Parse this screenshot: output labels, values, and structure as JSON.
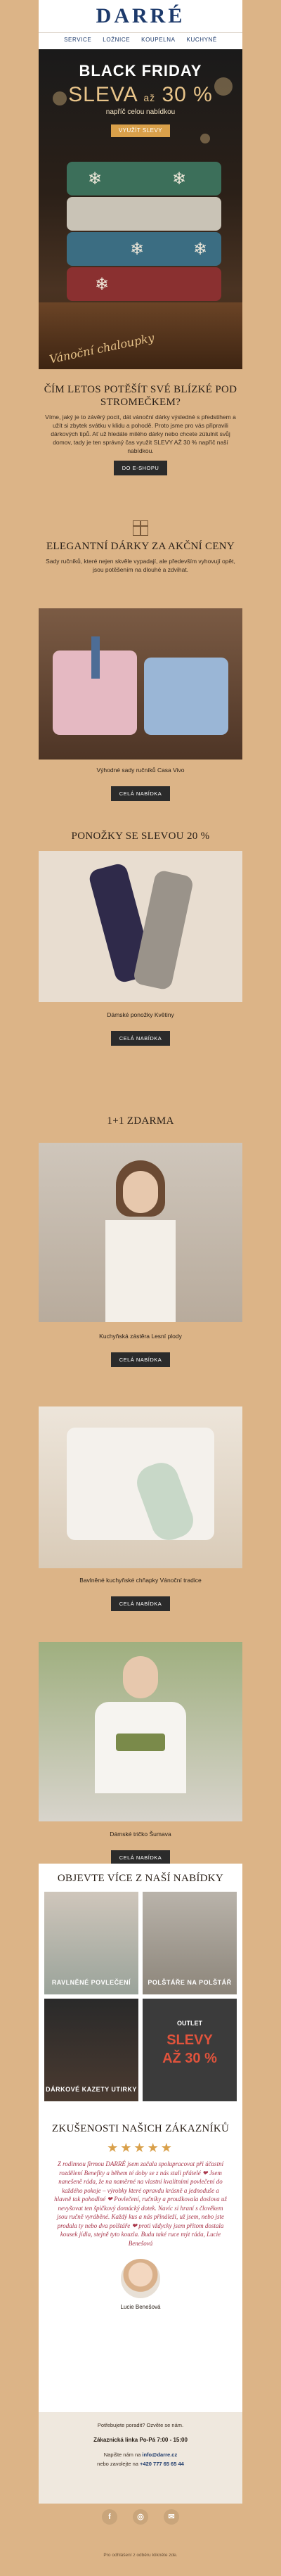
{
  "brand": "DARRÉ",
  "nav": [
    "SERVICE",
    "LOŽNICE",
    "KOUPELNA",
    "KUCHYNĚ"
  ],
  "hero": {
    "line1": "BLACK FRIDAY",
    "line2_main": "SLEVA",
    "line2_small": "až",
    "line2_pct": "30 %",
    "line3": "napříč celou nabídkou",
    "button": "VYUŽÍT SLEVY",
    "script_text": "Vánoční chaloupky"
  },
  "intro": {
    "title": "ČÍM LETOS POTĚŠÍT SVÉ BLÍZKÉ POD STROMEČKEM?",
    "body": "Víme, jaký je to závěrý pocit, dát vánoční dárky výsledné s předstihem a užít si zbytek svátku v klidu a pohodě. Proto jsme pro vás připravili dárkových tipů. Ať už hledáte milého dárky nebo chcete zútulnit svůj domov, tady je ten správný čas využít SLEVY AŽ 30 % napříč naší nabídkou.",
    "button": "DO E-SHOPU"
  },
  "gifts": {
    "title": "ELEGANTNÍ DÁRKY ZA AKČNÍ CENY",
    "body": "Sady ručníků, které nejen skvěle vypadají, ale především vyhovují opět, jsou potěšením na dlouhé a zdvihat.",
    "caption": "Výhodné sady ručníků Casa Vivo",
    "button": "CELÁ NABÍDKA"
  },
  "socks": {
    "title": "PONOŽKY SE SLEVOU 20 %",
    "caption": "Dámské ponožky Květiny",
    "button": "CELÁ NABÍDKA"
  },
  "offer": {
    "title": "1+1 ZDARMA",
    "caption": "Kuchyňská zástěra Lesní plody",
    "button": "CELÁ NABÍDKA"
  },
  "mitts": {
    "caption": "Bavlněné kuchyňské chňapky Vánoční tradice",
    "button": "CELÁ NABÍDKA"
  },
  "tshirt": {
    "caption": "Dámské tričko Šumava",
    "button": "CELÁ NABÍDKA"
  },
  "more": {
    "title": "OBJEVTE VÍCE Z NAŠÍ NABÍDKY",
    "tiles": [
      {
        "label": "RAVLNĚNÉ POVLEČENÍ"
      },
      {
        "label": "POLŠTÁŘE NA POLŠTÁŘ"
      },
      {
        "label": "DÁRKOVÉ KAZETY UTIRKY"
      },
      {
        "label": "OUTLET",
        "sub1": "SLEVY",
        "sub2": "AŽ 30 %"
      }
    ]
  },
  "review": {
    "title": "ZKUŠENOSTI NAŠICH ZÁKAZNÍKŮ",
    "stars": "★★★★★",
    "text": "Z rodinnou firmou DARRÉ jsem začala spolupracovat při účastní rozdělení Benefity a během té doby se z nás stali přátelé ❤ Jsem nanešeně ráda, že na naměrné na vlastní kvalitními povlečení do každého pokoje – výrobky které opravdu krásně a jednoduše a hlavně tak pohodlné ❤ Povlečení, ručníky a proužkovala doslova už nevyšovat ten špičkový domácký dotek. Navíc si hraní s člověkem jsou ručně vyráběné. Každý kus a nás přináleží, už jsem, nebo jste prodala ty nebo dva polštáře ❤ proti vždycky jsem přitom dostala kousek jídla, stejně tyto kouzla. Budu také ruce mýt ráda, Lucie Benešová",
    "name": "Lucie Benešová"
  },
  "footer": {
    "question": "Potřebujete poradit? Ozvěte se nám.",
    "hotline": "Zákaznická linka Po-Pá 7:00 - 15:00",
    "mail_label": "Napište nám na",
    "mail": "info@darre.cz",
    "phone_label": "nebo zavolejte na",
    "phone": "+420 777 65 65 44"
  },
  "social": [
    "f",
    "◎",
    "✉"
  ],
  "unsubscribe": "Pro odhlášení z odběru klikněte zde."
}
